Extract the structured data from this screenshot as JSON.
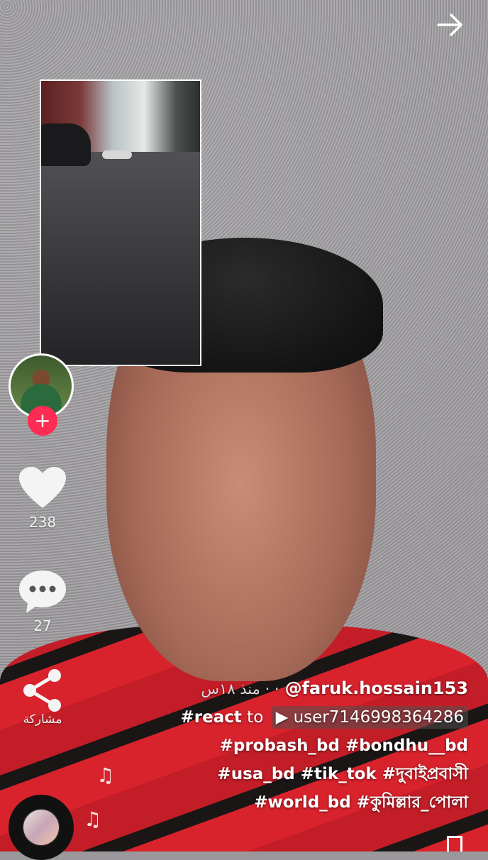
{
  "top_bar": {
    "forward_icon": "arrow-right-icon"
  },
  "reacted_video": {
    "label": ""
  },
  "rail": {
    "follow_symbol": "+",
    "like_count": "238",
    "comment_count": "27",
    "share_label": "مشاركة"
  },
  "caption": {
    "time_label": "منذ ١٨س · ·",
    "username": "@faruk.hossain153",
    "react_prefix": "#react",
    "react_to": "to",
    "react_user": "user7146998364286",
    "line3": "#probash_bd #bondhu__bd",
    "line4": "#usa_bd #tik_tok #দুবাইপ্রবাসী",
    "line5": "#world_bd #কুমিল্লার_পোলা"
  },
  "colors": {
    "accent": "#fe2c55",
    "text": "#ffffff"
  }
}
